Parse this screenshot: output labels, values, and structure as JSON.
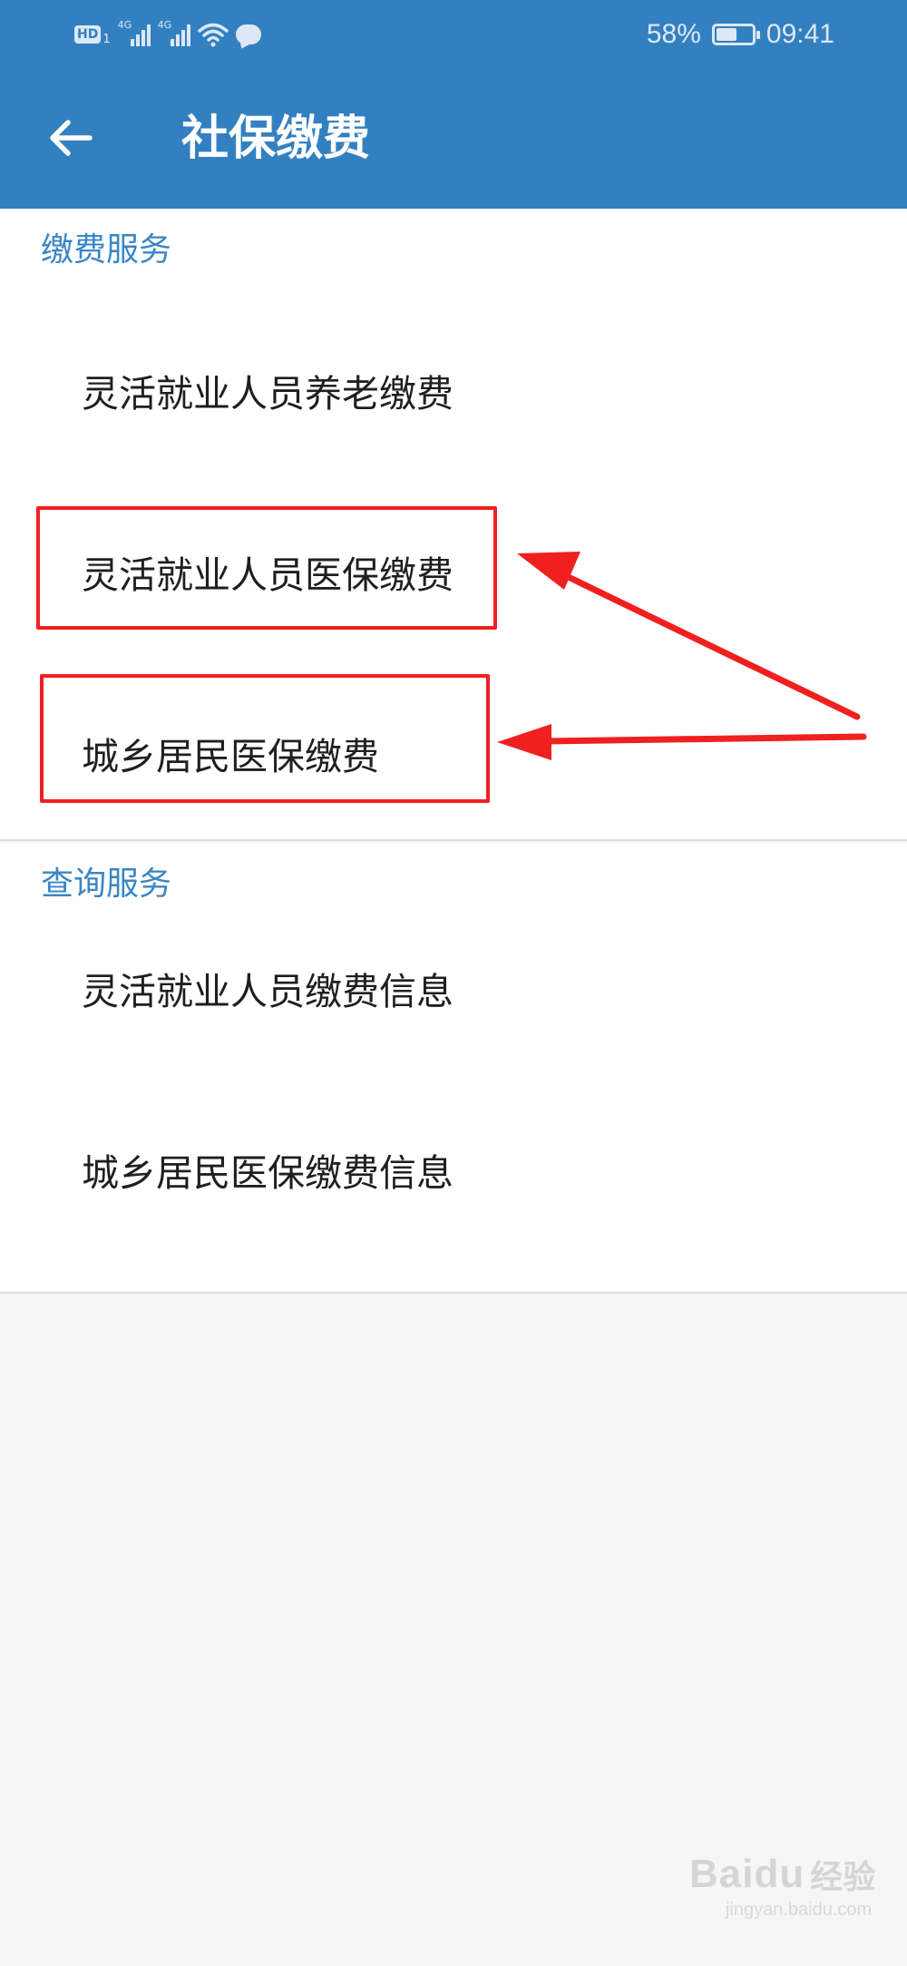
{
  "status_bar": {
    "hd_label": "HD",
    "sim_number": "1",
    "signal_tag_1": "4G",
    "signal_tag_2": "4G",
    "battery_percent": "58%",
    "battery_level": 0.58,
    "time": "09:41",
    "icons": [
      "hd-icon",
      "signal-icon",
      "signal-icon",
      "wifi-icon",
      "message-icon",
      "battery-icon"
    ]
  },
  "app_bar": {
    "back_icon": "arrow-left-icon",
    "title": "社保缴费"
  },
  "sections": [
    {
      "header": "缴费服务",
      "items": [
        {
          "label": "灵活就业人员养老缴费"
        },
        {
          "label": "灵活就业人员医保缴费"
        },
        {
          "label": "城乡居民医保缴费"
        }
      ]
    },
    {
      "header": "查询服务",
      "items": [
        {
          "label": "灵活就业人员缴费信息"
        },
        {
          "label": "城乡居民医保缴费信息"
        }
      ]
    }
  ],
  "colors": {
    "app_bar": "#3380c1",
    "section_header": "#3a86c4",
    "annotation": "#f02020",
    "page_background": "#f6f6f6"
  },
  "watermark": {
    "logo": "Bai",
    "logo_tail": "du",
    "text": "经验",
    "url": "jingyan.baidu.com"
  }
}
